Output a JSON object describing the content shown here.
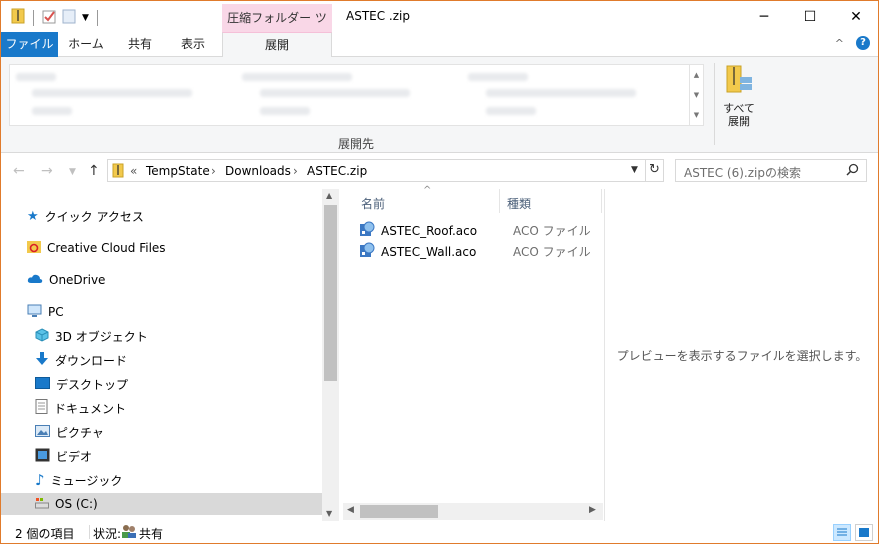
{
  "window": {
    "title": "ASTEC .zip",
    "contextual_tab_header": "圧縮フォルダー ツール",
    "controls": {
      "minimize": "─",
      "maximize": "☐",
      "close": "✕"
    }
  },
  "ribbon": {
    "tabs": [
      {
        "label": "ファイル"
      },
      {
        "label": "ホーム"
      },
      {
        "label": "共有"
      },
      {
        "label": "表示"
      },
      {
        "label": "展開"
      }
    ],
    "group_label": "展開先",
    "extract_all_line1": "すべて",
    "extract_all_line2": "展開",
    "collapse_glyph": "^",
    "help_glyph": "?"
  },
  "address_bar": {
    "overflow": "«",
    "segments": [
      "TempState",
      "Downloads",
      "ASTEC.zip"
    ],
    "separator": "›",
    "search_placeholder": "ASTEC (6).zipの検索"
  },
  "nav_pane": {
    "items": [
      {
        "label": "クイック アクセス",
        "icon": "star-icon"
      },
      {
        "label": "Creative Cloud Files",
        "icon": "creative-cloud-icon"
      },
      {
        "label": "OneDrive",
        "icon": "cloud-icon"
      },
      {
        "label": "PC",
        "icon": "computer-icon"
      },
      {
        "label": "3D オブジェクト",
        "icon": "cube-icon"
      },
      {
        "label": "ダウンロード",
        "icon": "download-arrow-icon"
      },
      {
        "label": "デスクトップ",
        "icon": "desktop-icon"
      },
      {
        "label": "ドキュメント",
        "icon": "document-icon"
      },
      {
        "label": "ピクチャ",
        "icon": "picture-icon"
      },
      {
        "label": "ビデオ",
        "icon": "video-icon"
      },
      {
        "label": "ミュージック",
        "icon": "music-note-icon"
      },
      {
        "label": "OS (C:)",
        "icon": "drive-icon"
      }
    ]
  },
  "file_list": {
    "columns": [
      "名前",
      "種類"
    ],
    "sort_glyph": "^",
    "rows": [
      {
        "name": "ASTEC_Roof.aco",
        "type": "ACO ファイル"
      },
      {
        "name": "ASTEC_Wall.aco",
        "type": "ACO ファイル"
      }
    ]
  },
  "preview": {
    "message": "プレビューを表示するファイルを選択します。"
  },
  "status_bar": {
    "item_count": "2 個の項目",
    "state_label": "状況:",
    "state_value": "共有"
  },
  "colors": {
    "accent": "#1979ca",
    "contextual_tab": "#f9d7e7",
    "window_border": "#e07b2c"
  }
}
